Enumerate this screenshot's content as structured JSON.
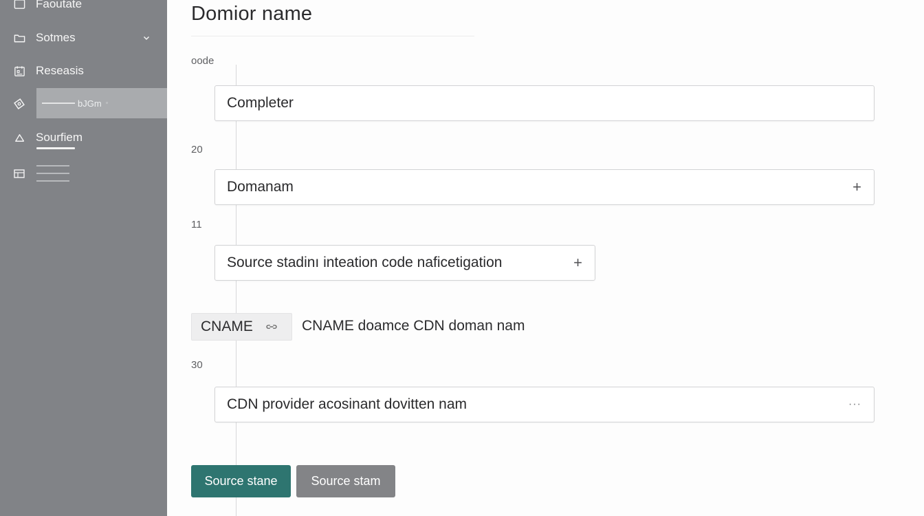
{
  "sidebar": {
    "items": [
      {
        "label": "Faoutate",
        "icon": "square-icon"
      },
      {
        "label": "Sotmes",
        "icon": "folder-icon"
      },
      {
        "label": "Reseasis",
        "icon": "calendar-icon"
      },
      {
        "label": "bJGm",
        "icon": "tag-icon"
      },
      {
        "label": "Sourfiem",
        "icon": "cloud-icon"
      },
      {
        "label": "",
        "icon": "table-icon"
      }
    ],
    "selected_suffix": "◦"
  },
  "main": {
    "title": "Domior name",
    "rows": [
      {
        "label": "oode",
        "value": "Completer",
        "trailing": ""
      },
      {
        "label": "20",
        "value": "Domanam",
        "trailing": "+"
      },
      {
        "label": "11",
        "value": "Source stadinı inteation code naficetigation",
        "trailing": "+"
      }
    ],
    "cname": {
      "tag": "CNAME",
      "text": "CNAME doamce CDN doman nam"
    },
    "row30": {
      "label": "30",
      "value": "CDN provider acosinant dovitten nam",
      "trailing": "···"
    },
    "buttons": {
      "primary": "Source stane",
      "secondary": "Source stam"
    }
  },
  "colors": {
    "sidebar_bg": "#818387",
    "selected_bg": "#a9abae",
    "primary_button": "#2e7570",
    "secondary_button": "#838487"
  }
}
